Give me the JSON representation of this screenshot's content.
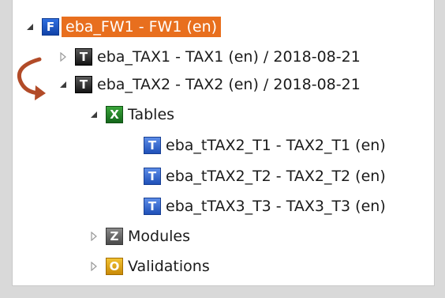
{
  "tree": {
    "root": {
      "icon_letter": "F",
      "label": "eba_FW1 - FW1 (en)",
      "expanded": true,
      "selected": true
    },
    "tax1": {
      "icon_letter": "T",
      "label": "eba_TAX1 - TAX1 (en) / 2018-08-21",
      "expanded": false
    },
    "tax2": {
      "icon_letter": "T",
      "label": "eba_TAX2 - TAX2 (en) / 2018-08-21",
      "expanded": true
    },
    "tables": {
      "icon_letter": "X",
      "label": "Tables",
      "expanded": true
    },
    "table_items": [
      {
        "icon_letter": "T",
        "label": "eba_tTAX2_T1 - TAX2_T1 (en)"
      },
      {
        "icon_letter": "T",
        "label": "eba_tTAX2_T2 - TAX2_T2 (en)"
      },
      {
        "icon_letter": "T",
        "label": "eba_tTAX3_T3 - TAX3_T3 (en)"
      }
    ],
    "modules": {
      "icon_letter": "Z",
      "label": "Modules",
      "expanded": false
    },
    "validations": {
      "icon_letter": "O",
      "label": "Validations",
      "expanded": false
    }
  },
  "colors": {
    "selection": "#e86f1e",
    "annotation_arrow": "#b24b28"
  }
}
